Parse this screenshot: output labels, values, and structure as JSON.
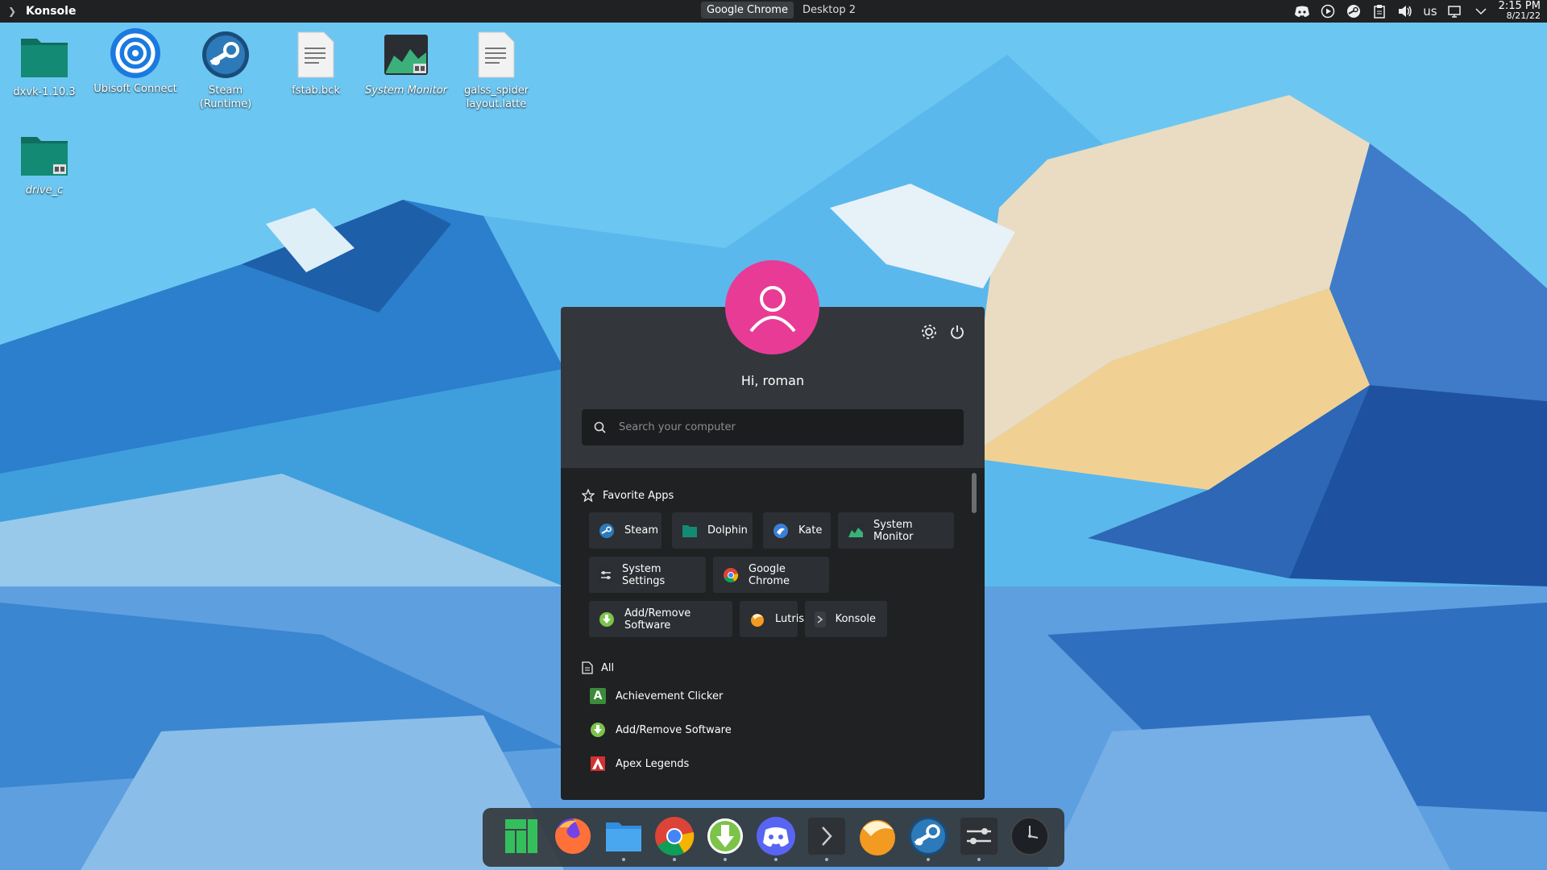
{
  "topbar": {
    "active_app": "Konsole",
    "pager": [
      "Google Chrome",
      "Desktop 2"
    ],
    "tray_icons": [
      "discord-icon",
      "media-play-icon",
      "steam-icon",
      "clipboard-icon",
      "volume-icon",
      "keyboard-layout",
      "network-icon",
      "expand-arrow-icon"
    ],
    "keyboard_layout": "us",
    "time": "2:15 PM",
    "date": "8/21/22"
  },
  "desktop": {
    "icons": [
      {
        "label": "dxvk-1.10.3",
        "icon": "folder-icon"
      },
      {
        "label": "Ubisoft Connect",
        "icon": "ubisoft-icon"
      },
      {
        "label": "Steam (Runtime)",
        "icon": "steam-icon"
      },
      {
        "label": "fstab.bck",
        "icon": "text-file-icon"
      },
      {
        "label": "System Monitor",
        "icon": "system-monitor-icon"
      },
      {
        "label": "galss_spider layout.latte",
        "icon": "text-file-icon"
      },
      {
        "label": "drive_c",
        "icon": "folder-link-icon"
      }
    ]
  },
  "launcher": {
    "greeting": "Hi, roman",
    "search_placeholder": "Search your computer",
    "favorites_title": "Favorite Apps",
    "favorites": [
      "Steam",
      "Dolphin",
      "Kate",
      "System Monitor",
      "System Settings",
      "Google Chrome",
      "Add/Remove Software",
      "Lutris",
      "Konsole"
    ],
    "all_title": "All",
    "all_apps": [
      "Achievement Clicker",
      "Add/Remove Software",
      "Apex Legends"
    ]
  },
  "dock": {
    "items": [
      "manjaro-icon",
      "firefox-icon",
      "files-icon",
      "chrome-icon",
      "software-update-icon",
      "discord-icon",
      "konsole-icon",
      "lutris-icon",
      "steam-icon",
      "settings-icon",
      "clock-icon"
    ]
  },
  "colors": {
    "avatar": "#e83b96",
    "panel": "#1f2123",
    "launcher_header": "#33373b"
  }
}
